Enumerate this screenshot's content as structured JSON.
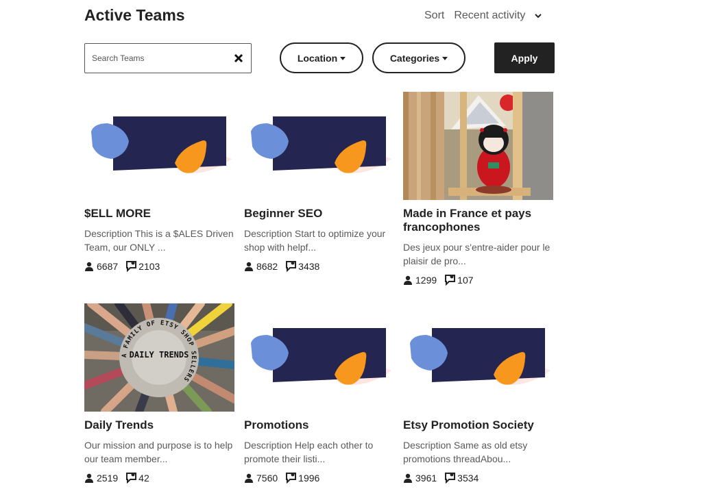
{
  "header": {
    "title": "Active Teams",
    "sort_label": "Sort",
    "sort_value": "Recent activity"
  },
  "filters": {
    "search_placeholder": "Search Teams",
    "location_label": "Location",
    "categories_label": "Categories",
    "apply_label": "Apply"
  },
  "teams": [
    {
      "name": "$ELL MORE",
      "description": "Description This is a $ALES Driven Team, our ONLY ...",
      "members": "6687",
      "posts": "2103",
      "image": "default-banner"
    },
    {
      "name": "Beginner SEO",
      "description": "Description Start to optimize your shop with helpf...",
      "members": "8682",
      "posts": "3438",
      "image": "default-banner"
    },
    {
      "name": "Made in France et pays francophones",
      "description": "Des jeux pour s'entre-aider pour le plaisir de pro...",
      "members": "1299",
      "posts": "107",
      "image": "kokeshi-doll-photo"
    },
    {
      "name": "Daily Trends",
      "description": "Our mission and purpose is to help our team member...",
      "members": "2519",
      "posts": "42",
      "image": "hands-circle-photo",
      "image_text": "DAILY TRENDS",
      "image_ring_text": "A FAMILY OF ETSY SHOP SELLERS"
    },
    {
      "name": "Promotions",
      "description": "Description Help each other to promote their listi...",
      "members": "7560",
      "posts": "1996",
      "image": "default-banner"
    },
    {
      "name": "Etsy Promotion Society",
      "description": "Description Same as old etsy promotions threadAbou...",
      "members": "3961",
      "posts": "3534",
      "image": "default-banner"
    }
  ],
  "colors": {
    "navy": "#252552",
    "blue": "#6b8fd8",
    "orange": "#f7971d",
    "pink": "#fbe6e2"
  }
}
